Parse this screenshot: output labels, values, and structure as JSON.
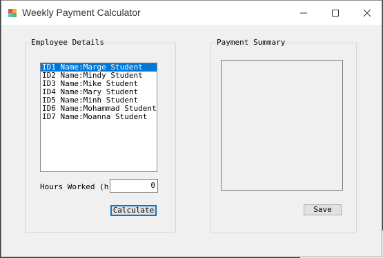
{
  "window": {
    "title": "Weekly Payment Calculator"
  },
  "titlebar_controls": {
    "minimize_icon": "minimize-icon",
    "maximize_icon": "maximize-icon",
    "close_icon": "close-icon"
  },
  "employee_group": {
    "title": "Employee Details",
    "employees": [
      "ID1 Name:Marge Student",
      "ID2 Name:Mindy Student",
      "ID3 Name:Mike Student",
      "ID4 Name:Mary Student",
      "ID5 Name:Minh Student",
      "ID6 Name:Mohammad Student",
      "ID7 Name:Moanna Student"
    ],
    "selected_index": 0,
    "hours_label": "Hours Worked (hrs)",
    "hours_value": "0",
    "calculate_label": "Calculate"
  },
  "summary_group": {
    "title": "Payment Summary",
    "summary_text": "",
    "save_label": "Save"
  },
  "colors": {
    "selection": "#0078d7",
    "window_bg": "#f0f0f0"
  }
}
